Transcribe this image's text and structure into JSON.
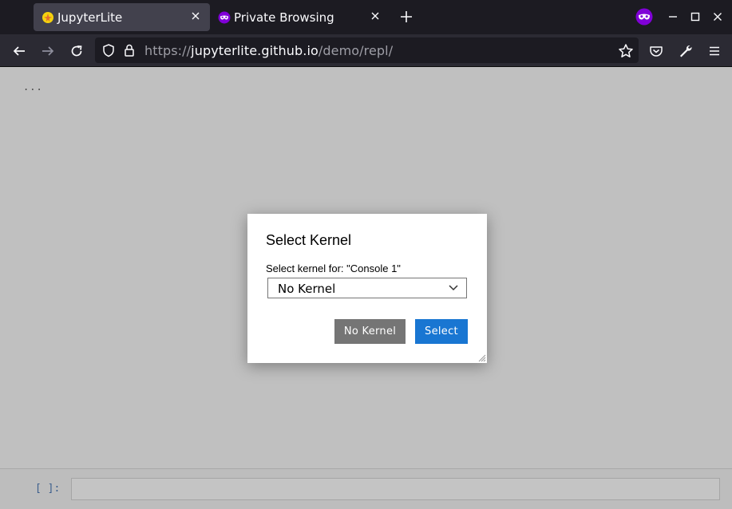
{
  "browser": {
    "tabs": [
      {
        "title": "JupyterLite",
        "active": true,
        "favicon": "jupyterlite-logo-icon"
      },
      {
        "title": "Private Browsing",
        "active": false,
        "favicon": "private-browsing-mask-icon"
      }
    ],
    "url": {
      "scheme": "https://",
      "host": "jupyterlite.github.io",
      "path": "/demo/repl/"
    },
    "colors": {
      "tabbar": "#1c1b22",
      "active_tab": "#42414d",
      "navbar": "#2b2a33",
      "private_accent": "#8000d7"
    }
  },
  "page": {
    "ellipsis": "...",
    "console_prompt": "[ ]:"
  },
  "dialog": {
    "title": "Select Kernel",
    "label": "Select kernel for: \"Console 1\"",
    "selected_kernel": "No Kernel",
    "buttons": {
      "no_kernel": "No Kernel",
      "select": "Select"
    },
    "colors": {
      "primary": "#1976d2",
      "secondary": "#757575"
    }
  }
}
